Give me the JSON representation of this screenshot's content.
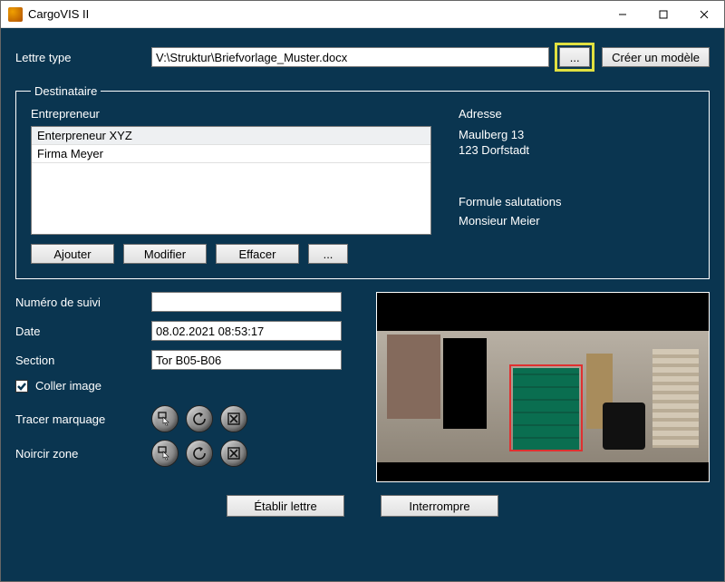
{
  "window": {
    "title": "CargoVIS II"
  },
  "template": {
    "label": "Lettre type",
    "path": "V:\\Struktur\\Briefvorlage_Muster.docx",
    "browse_label": "...",
    "create_label": "Créer un modèle"
  },
  "dest": {
    "legend": "Destinataire",
    "entrepreneur_label": "Entrepreneur",
    "items": [
      "Enterpreneur XYZ",
      "Firma Meyer"
    ],
    "buttons": {
      "add": "Ajouter",
      "modify": "Modifier",
      "delete": "Effacer",
      "more": "..."
    },
    "address_label": "Adresse",
    "address_line1": "Maulberg 13",
    "address_line2": "123 Dorfstadt",
    "salutation_label": "Formule salutations",
    "salutation_value": "Monsieur Meier"
  },
  "form": {
    "tracking_label": "Numéro de suivi",
    "tracking_value": "",
    "date_label": "Date",
    "date_value": "08.02.2021 08:53:17",
    "section_label": "Section",
    "section_value": "Tor B05-B06",
    "paste_image_label": "Coller image",
    "trace_label": "Tracer marquage",
    "blacken_label": "Noircir zone"
  },
  "tools": {
    "select": "select-rect-icon",
    "undo": "undo-icon",
    "clear": "clear-icon"
  },
  "actions": {
    "generate": "Établir lettre",
    "cancel": "Interrompre"
  }
}
